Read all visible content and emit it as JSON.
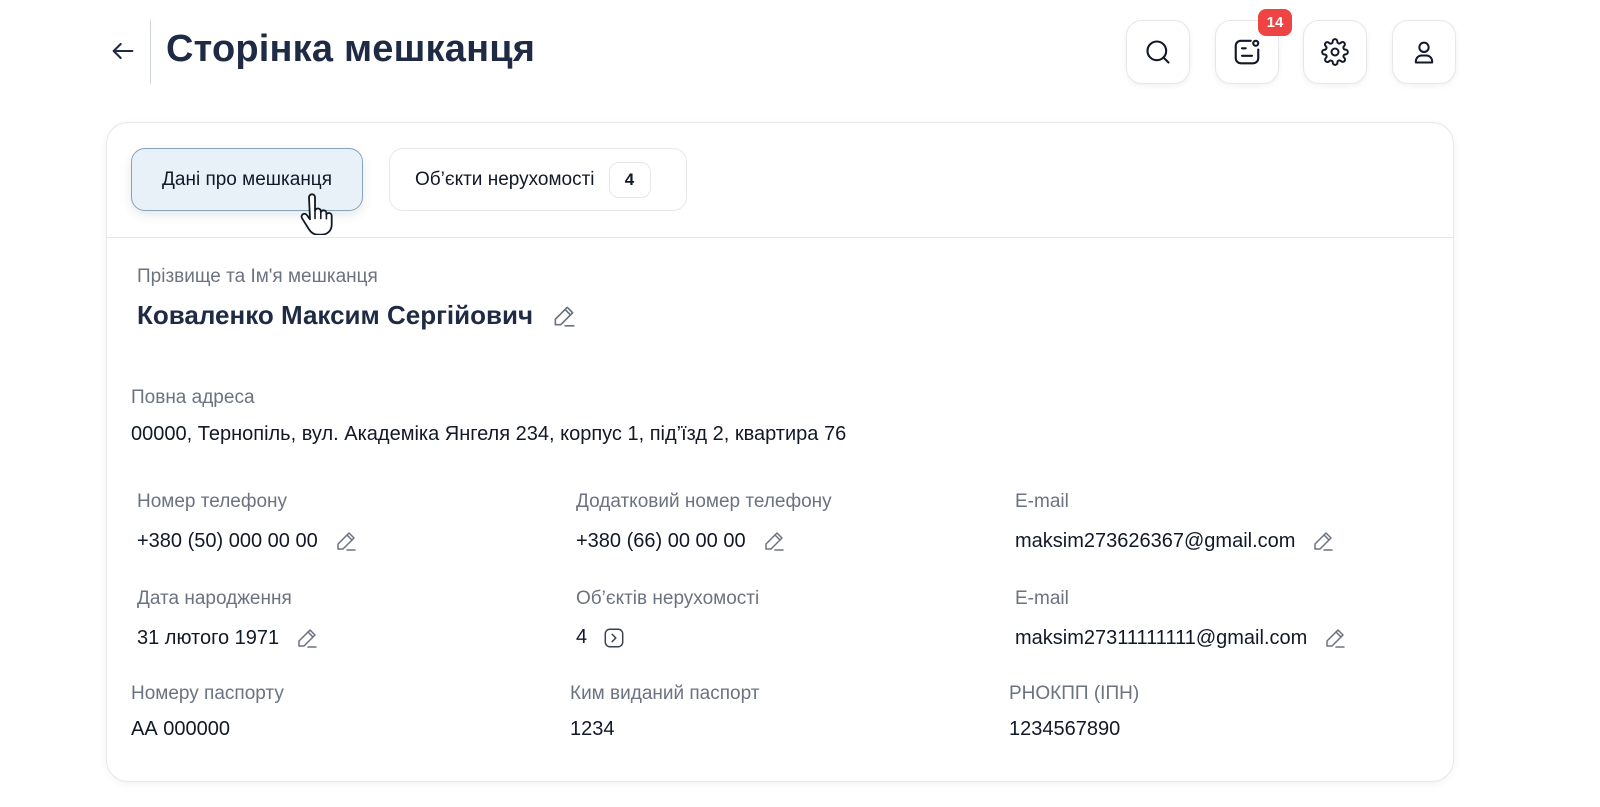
{
  "header": {
    "title": "Сторінка мешканця",
    "notification_count": "14"
  },
  "tabs": [
    {
      "label": "Дані про мешканця"
    },
    {
      "label": "Об’єкти нерухомості",
      "count": "4"
    }
  ],
  "resident": {
    "name_label": "Прізвище та Ім'я мешканця",
    "name": "Коваленко Максим Сергійович",
    "address_label": "Повна адреса",
    "address": "00000, Тернопіль, вул. Академіка Янгеля 234, корпус 1, під’їзд 2, квартира 76",
    "phone_label": "Номер телефону",
    "phone": "+380 (50) 000 00 00",
    "extra_phone_label": "Додатковий номер телефону",
    "extra_phone": "+380 (66) 00 00 00",
    "email_label": "E-mail",
    "email": "maksim273626367@gmail.com",
    "birth_label": "Дата народження",
    "birth": "31 лютого 1971",
    "objects_label": "Об’єктів нерухомості",
    "objects": "4",
    "email2_label": "E-mail",
    "email2": "maksim27311111111@gmail.com",
    "passport_label": "Номеру паспорту",
    "passport": "АА 000000",
    "passport_issuer_label": "Ким виданий паспорт",
    "passport_issuer": "1234",
    "tax_id_label": "РНОКПП (ІПН)",
    "tax_id": "1234567890"
  },
  "colors": {
    "accent_tab_bg": "#e7f1f7",
    "badge": "#ef4444",
    "title": "#1f2a44"
  },
  "icons": [
    "arrow-left-icon",
    "search-icon",
    "message-icon",
    "gear-icon",
    "user-icon",
    "pencil-icon",
    "chevron-right-icon",
    "hand-pointer-icon"
  ]
}
